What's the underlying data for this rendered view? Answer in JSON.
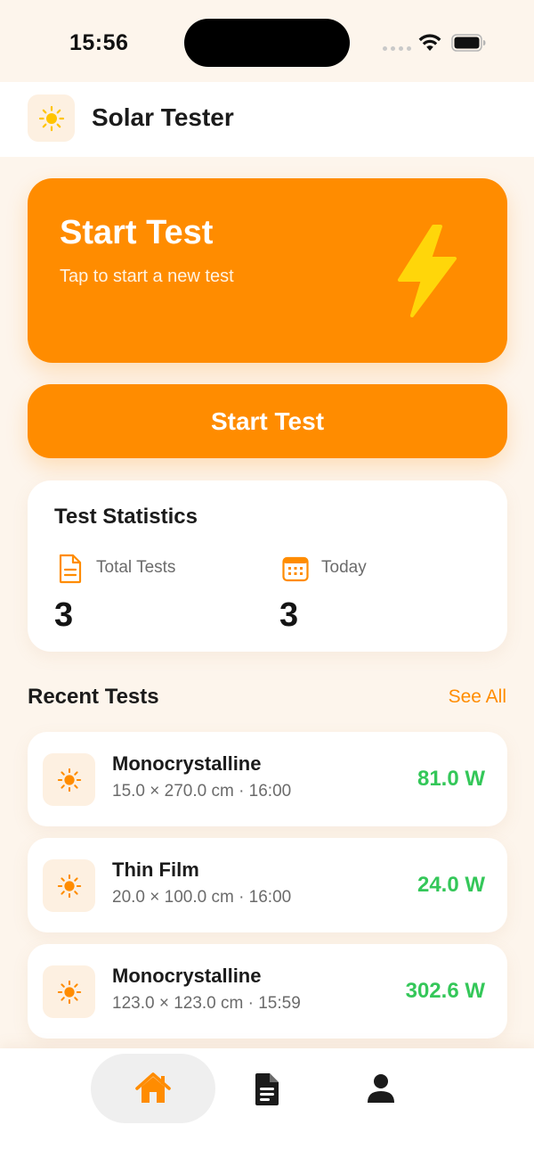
{
  "status_bar": {
    "time": "15:56"
  },
  "header": {
    "logo_icon": "sun-icon",
    "title": "Solar Tester"
  },
  "hero": {
    "title": "Start Test",
    "subtitle": "Tap to start a new test",
    "icon": "lightning-bolt-icon"
  },
  "start_button": {
    "label": "Start Test"
  },
  "statistics": {
    "title": "Test Statistics",
    "items": [
      {
        "icon": "document-icon",
        "label": "Total Tests",
        "value": "3"
      },
      {
        "icon": "calendar-icon",
        "label": "Today",
        "value": "3"
      }
    ]
  },
  "recent": {
    "title": "Recent Tests",
    "see_all_label": "See All",
    "items": [
      {
        "type": "Monocrystalline",
        "meta": "15.0 × 270.0 cm · 16:00",
        "power": "81.0 W"
      },
      {
        "type": "Thin Film",
        "meta": "20.0 × 100.0 cm · 16:00",
        "power": "24.0 W"
      },
      {
        "type": "Monocrystalline",
        "meta": "123.0 × 123.0 cm · 15:59",
        "power": "302.6 W"
      }
    ]
  },
  "tab_bar": {
    "tabs": [
      {
        "icon": "home-icon",
        "selected": true
      },
      {
        "icon": "document-icon",
        "selected": false
      },
      {
        "icon": "person-icon",
        "selected": false
      }
    ]
  },
  "colors": {
    "accent": "#ff8c00",
    "background": "#fdf5ec",
    "power_text": "#34c759",
    "bolt": "#ffd60a"
  }
}
